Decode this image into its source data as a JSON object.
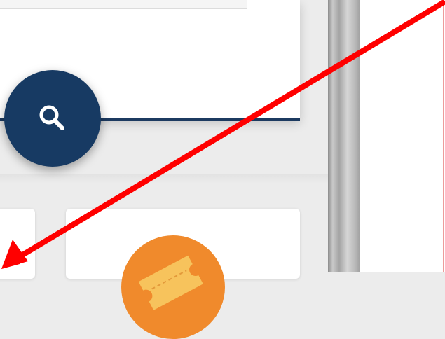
{
  "search": {
    "button_icon": "search-icon"
  },
  "categories": {
    "tile_icon": "ticket-icon"
  },
  "colors": {
    "primary_navy": "#173a63",
    "accent_orange": "#f08a2c",
    "ticket_yellow": "#f7c35c",
    "annotation_red": "#ff0000"
  }
}
